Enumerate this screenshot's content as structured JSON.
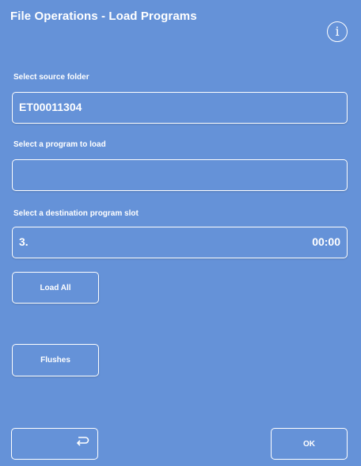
{
  "header": {
    "title": "File Operations - Load Programs",
    "info_icon": "i"
  },
  "source_folder": {
    "label": "Select source folder",
    "value": "ET00011304"
  },
  "program": {
    "label": "Select a program to load",
    "value": ""
  },
  "destination": {
    "label": "Select a destination program slot",
    "slot": "3.",
    "time": "00:00"
  },
  "buttons": {
    "load_all": "Load All",
    "flushes": "Flushes",
    "back_icon": "return-arrow-icon",
    "ok": "OK"
  },
  "colors": {
    "background": "#6592d8",
    "foreground": "#ffffff"
  }
}
